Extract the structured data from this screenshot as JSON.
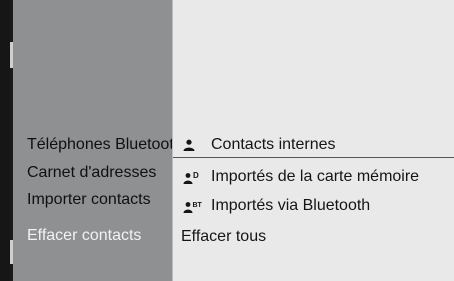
{
  "left_menu": {
    "items": [
      {
        "label": "Téléphones Bluetooth",
        "active": false
      },
      {
        "label": "Carnet d'adresses",
        "active": false
      },
      {
        "label": "Importer contacts",
        "active": false
      },
      {
        "label": "Effacer contacts",
        "active": true
      }
    ]
  },
  "submenu": {
    "items": [
      {
        "label": "Contacts internes",
        "icon": "person-icon",
        "badge": ""
      },
      {
        "label": "Importés de la carte mémoire",
        "icon": "person-memory-card-icon",
        "badge": "D"
      },
      {
        "label": "Importés via Bluetooth",
        "icon": "person-bluetooth-icon",
        "badge": "BT"
      },
      {
        "label": "Effacer tous",
        "icon": "",
        "badge": ""
      }
    ]
  },
  "colors": {
    "left_panel": "#8f9092",
    "right_panel": "#e9e9ea",
    "active_text": "#f2f2f2"
  }
}
